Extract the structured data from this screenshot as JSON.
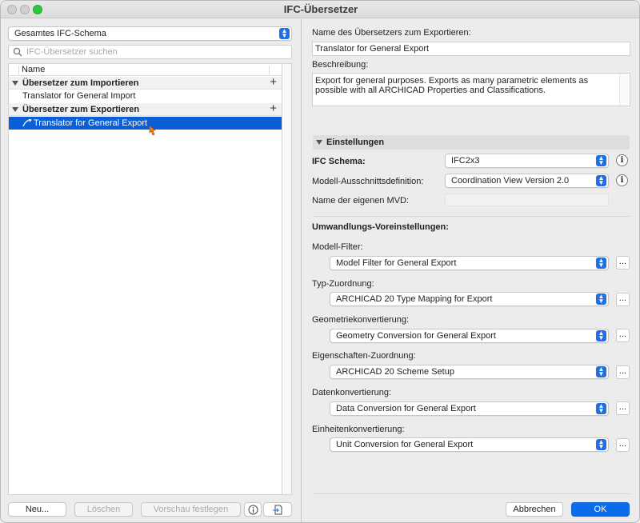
{
  "window": {
    "title": "IFC-Übersetzer"
  },
  "left": {
    "schema_popup": "Gesamtes IFC-Schema",
    "search_placeholder": "IFC-Übersetzer suchen",
    "list_header": "Name",
    "groups": [
      {
        "label": "Übersetzer zum Importieren",
        "items": [
          "Translator for General Import"
        ]
      },
      {
        "label": "Übersetzer zum Exportieren",
        "items": [
          "Translator for General Export"
        ]
      }
    ],
    "selected_item": "Translator for General Export",
    "buttons": {
      "new": "Neu...",
      "delete": "Löschen",
      "preview": "Vorschau festlegen"
    }
  },
  "right": {
    "name_label": "Name des Übersetzers zum Exportieren:",
    "name_value": "Translator for General Export",
    "description_label": "Beschreibung:",
    "description_value": "Export for general purposes. Exports as many parametric elements as possible with all ARCHICAD Properties and Classifications.",
    "settings_section": "Einstellungen",
    "ifc_schema_label": "IFC Schema:",
    "ifc_schema_value": "IFC2x3",
    "mvd_label": "Modell-Ausschnittsdefinition:",
    "mvd_value": "Coordination View Version 2.0",
    "custom_mvd_label": "Name der eigenen MVD:",
    "conversion_heading": "Umwandlungs-Voreinstellungen:",
    "conversions": [
      {
        "label": "Modell-Filter:",
        "value": "Model Filter for General Export"
      },
      {
        "label": "Typ-Zuordnung:",
        "value": "ARCHICAD 20 Type Mapping for Export"
      },
      {
        "label": "Geometriekonvertierung:",
        "value": "Geometry Conversion for General Export"
      },
      {
        "label": "Eigenschaften-Zuordnung:",
        "value": "ARCHICAD 20 Scheme Setup"
      },
      {
        "label": "Datenkonvertierung:",
        "value": "Data Conversion for General Export"
      },
      {
        "label": "Einheitenkonvertierung:",
        "value": "Unit Conversion for General Export"
      }
    ],
    "dots_label": "...",
    "buttons": {
      "cancel": "Abbrechen",
      "ok": "OK"
    }
  }
}
